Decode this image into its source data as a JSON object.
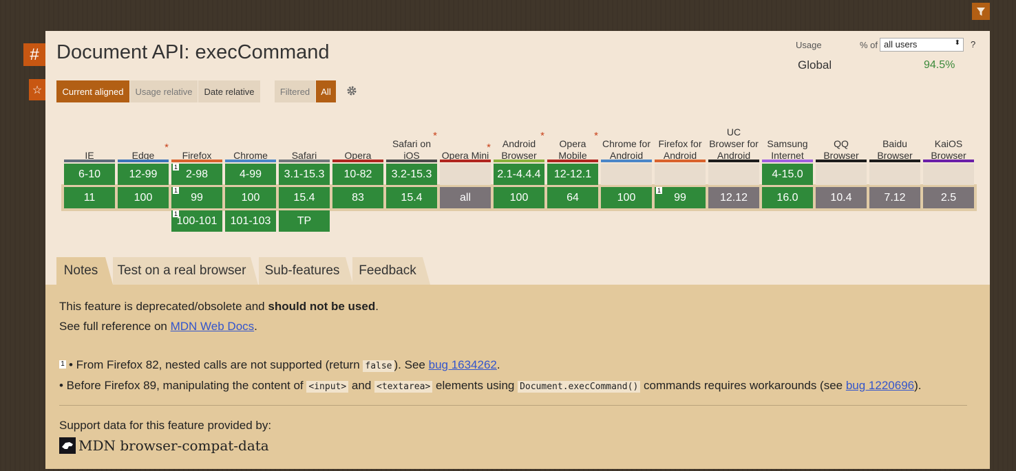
{
  "header": {
    "filter_icon": "filter-icon",
    "anchor_label": "#",
    "star_label": "☆"
  },
  "feature": {
    "title": "Document API: execCommand"
  },
  "usage": {
    "label": "Usage",
    "pct_label": "% of",
    "select_value": "all users",
    "help": "?",
    "region": "Global",
    "value": "94.5%"
  },
  "view_buttons": [
    {
      "label": "Current aligned"
    },
    {
      "label": "Usage relative"
    },
    {
      "label": "Date relative"
    },
    {
      "label": "Filtered"
    },
    {
      "label": "All"
    }
  ],
  "browsers": [
    {
      "name": "IE",
      "color": "#5d6b7b",
      "rows": [
        "6-10",
        "11",
        ""
      ],
      "types": [
        "g",
        "g",
        ""
      ]
    },
    {
      "name": "Edge",
      "asterisk": "*",
      "color": "#3b74b8",
      "rows": [
        "12-99",
        "100",
        ""
      ],
      "types": [
        "g",
        "g",
        ""
      ]
    },
    {
      "name": "Firefox",
      "color": "#d9632d",
      "rows": [
        "2-98",
        "99",
        "100-101"
      ],
      "types": [
        "g",
        "g",
        "g"
      ],
      "notes": [
        "1",
        "1",
        "1"
      ]
    },
    {
      "name": "Chrome",
      "color": "#4a86c8",
      "rows": [
        "4-99",
        "100",
        "101-103"
      ],
      "types": [
        "g",
        "g",
        "g"
      ]
    },
    {
      "name": "Safari",
      "color": "#71777c",
      "rows": [
        "3.1-15.3",
        "15.4",
        "TP"
      ],
      "types": [
        "g",
        "g",
        "g"
      ]
    },
    {
      "name": "Opera",
      "color": "#b0261f",
      "rows": [
        "10-82",
        "83",
        ""
      ],
      "types": [
        "g",
        "g",
        ""
      ]
    },
    {
      "name": "Safari on iOS",
      "asterisk": "*",
      "color": "#4b4b4b",
      "rows": [
        "3.2-15.3",
        "15.4",
        ""
      ],
      "types": [
        "g",
        "g",
        ""
      ]
    },
    {
      "name": "Opera Mini",
      "asterisk": "*",
      "color": "#b0261f",
      "rows": [
        "",
        "all",
        ""
      ],
      "types": [
        "e",
        "u",
        ""
      ]
    },
    {
      "name": "Android Browser",
      "asterisk": "*",
      "color": "#8ab13b",
      "rows": [
        "2.1-4.4.4",
        "100",
        ""
      ],
      "types": [
        "g",
        "g",
        ""
      ]
    },
    {
      "name": "Opera Mobile",
      "asterisk": "*",
      "color": "#b0261f",
      "rows": [
        "12-12.1",
        "64",
        ""
      ],
      "types": [
        "g",
        "g",
        ""
      ]
    },
    {
      "name": "Chrome for Android",
      "color": "#4a86c8",
      "rows": [
        "",
        "100",
        ""
      ],
      "types": [
        "e",
        "g",
        ""
      ]
    },
    {
      "name": "Firefox for Android",
      "color": "#d9632d",
      "rows": [
        "",
        "99",
        ""
      ],
      "types": [
        "e",
        "g",
        ""
      ],
      "notes": [
        "",
        "1",
        ""
      ]
    },
    {
      "name": "UC Browser for Android",
      "color": "#1c1c1c",
      "rows": [
        "",
        "12.12",
        ""
      ],
      "types": [
        "e",
        "u",
        ""
      ]
    },
    {
      "name": "Samsung Internet",
      "color": "#a060e0",
      "rows": [
        "4-15.0",
        "16.0",
        ""
      ],
      "types": [
        "g",
        "g",
        ""
      ]
    },
    {
      "name": "QQ Browser",
      "color": "#1c1c1c",
      "rows": [
        "",
        "10.4",
        ""
      ],
      "types": [
        "e",
        "u",
        ""
      ]
    },
    {
      "name": "Baidu Browser",
      "color": "#1c1c1c",
      "rows": [
        "",
        "7.12",
        ""
      ],
      "types": [
        "e",
        "u",
        ""
      ]
    },
    {
      "name": "KaiOS Browser",
      "color": "#6a1fa8",
      "rows": [
        "",
        "2.5",
        ""
      ],
      "types": [
        "e",
        "u",
        ""
      ]
    }
  ],
  "tabs": [
    {
      "label": "Notes"
    },
    {
      "label": "Test on a real browser"
    },
    {
      "label": "Sub-features"
    },
    {
      "label": "Feedback"
    }
  ],
  "notes": {
    "line1_pre": "This feature is deprecated/obsolete and ",
    "line1_bold": "should not be used",
    "line1_post": ".",
    "line2_pre": "See full reference on ",
    "line2_link": "MDN Web Docs",
    "line2_post": ".",
    "fn1_marker": "1",
    "fn1_pre": "• From Firefox 82, nested calls are not supported (return ",
    "fn1_code": "false",
    "fn1_mid": "). See ",
    "fn1_link": "bug 1634262",
    "fn1_post": ".",
    "fn2_pre": "• Before Firefox 89, manipulating the content of ",
    "fn2_code1": "<input>",
    "fn2_and": " and ",
    "fn2_code2": "<textarea>",
    "fn2_mid": " elements using ",
    "fn2_code3": "Document.execCommand()",
    "fn2_mid2": " commands requires workarounds (see ",
    "fn2_link": "bug 1220696",
    "fn2_post": ").",
    "support_label": "Support data for this feature provided by:",
    "mdn_label": "MDN browser-compat-data"
  }
}
